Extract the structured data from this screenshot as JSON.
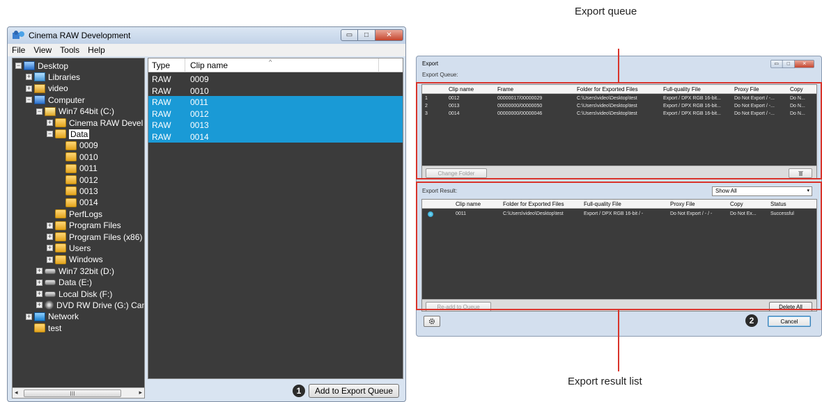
{
  "left_window": {
    "title": "Cinema RAW Development",
    "menu": [
      "File",
      "View",
      "Tools",
      "Help"
    ],
    "tree": [
      {
        "label": "Desktop",
        "icon": "computer",
        "depth": 0,
        "exp": "−"
      },
      {
        "label": "Libraries",
        "icon": "lib",
        "depth": 1,
        "exp": "+"
      },
      {
        "label": "video",
        "icon": "video",
        "depth": 1,
        "exp": "+"
      },
      {
        "label": "Computer",
        "icon": "computer",
        "depth": 1,
        "exp": "−"
      },
      {
        "label": "Win7 64bit (C:)",
        "icon": "winicon",
        "depth": 2,
        "exp": "−"
      },
      {
        "label": "Cinema RAW Devel",
        "icon": "folder",
        "depth": 3,
        "exp": "+"
      },
      {
        "label": "Data",
        "icon": "folder",
        "depth": 3,
        "exp": "−",
        "selected": true
      },
      {
        "label": "0009",
        "icon": "folder",
        "depth": 4,
        "exp": ""
      },
      {
        "label": "0010",
        "icon": "folder",
        "depth": 4,
        "exp": ""
      },
      {
        "label": "0011",
        "icon": "folder",
        "depth": 4,
        "exp": ""
      },
      {
        "label": "0012",
        "icon": "folder",
        "depth": 4,
        "exp": ""
      },
      {
        "label": "0013",
        "icon": "folder",
        "depth": 4,
        "exp": ""
      },
      {
        "label": "0014",
        "icon": "folder",
        "depth": 4,
        "exp": ""
      },
      {
        "label": "PerfLogs",
        "icon": "folder",
        "depth": 3,
        "exp": ""
      },
      {
        "label": "Program Files",
        "icon": "folder",
        "depth": 3,
        "exp": "+"
      },
      {
        "label": "Program Files (x86)",
        "icon": "folder",
        "depth": 3,
        "exp": "+"
      },
      {
        "label": "Users",
        "icon": "folder",
        "depth": 3,
        "exp": "+"
      },
      {
        "label": "Windows",
        "icon": "folder",
        "depth": 3,
        "exp": "+"
      },
      {
        "label": "Win7 32bit (D:)",
        "icon": "drive",
        "depth": 2,
        "exp": "+"
      },
      {
        "label": "Data (E:)",
        "icon": "drive",
        "depth": 2,
        "exp": "+"
      },
      {
        "label": "Local Disk (F:)",
        "icon": "drive",
        "depth": 2,
        "exp": "+"
      },
      {
        "label": "DVD RW Drive (G:) Can",
        "icon": "dvd",
        "depth": 2,
        "exp": "+"
      },
      {
        "label": "Network",
        "icon": "network",
        "depth": 1,
        "exp": "+"
      },
      {
        "label": "test",
        "icon": "folder",
        "depth": 1,
        "exp": ""
      }
    ],
    "scroll_label": "III",
    "clip_headers": {
      "type": "Type",
      "clip_name": "Clip name"
    },
    "clips": [
      {
        "type": "RAW",
        "name": "0009",
        "selected": false
      },
      {
        "type": "RAW",
        "name": "0010",
        "selected": false
      },
      {
        "type": "RAW",
        "name": "0011",
        "selected": true
      },
      {
        "type": "RAW",
        "name": "0012",
        "selected": true
      },
      {
        "type": "RAW",
        "name": "0013",
        "selected": true
      },
      {
        "type": "RAW",
        "name": "0014",
        "selected": true
      }
    ],
    "add_button": "Add to Export Queue",
    "badge": "1"
  },
  "export_window": {
    "title": "Export",
    "queue_label": "Export Queue:",
    "queue_headers": [
      "Clip name",
      "Frame",
      "Folder for Exported Files",
      "Full-quality File",
      "Proxy File",
      "Copy"
    ],
    "queue_rows": [
      [
        "1",
        "0012",
        "00000017/00000029",
        "C:\\Users\\video\\Desktop\\test",
        "Export / DPX RGB 16-bit...",
        "Do Not Export / -...",
        "Do N..."
      ],
      [
        "2",
        "0013",
        "00000000/00000050",
        "C:\\Users\\video\\Desktop\\test",
        "Export / DPX RGB 16-bit...",
        "Do Not Export / -...",
        "Do N..."
      ],
      [
        "3",
        "0014",
        "00000000/00000046",
        "C:\\Users\\video\\Desktop\\test",
        "Export / DPX RGB 16-bit...",
        "Do Not Export / -...",
        "Do N..."
      ]
    ],
    "change_folder": "Change Folder",
    "result_label": "Export Result:",
    "show_all": "Show All",
    "result_headers": [
      "Clip name",
      "Folder for Exported Files",
      "Full-quality File",
      "Proxy File",
      "Copy",
      "Status"
    ],
    "result_rows": [
      [
        "0011",
        "C:\\Users\\video\\Desktop\\test",
        "Export / DPX RGB 16-bit / -",
        "Do Not Export / - / -",
        "Do Not Ex...",
        "Successful"
      ]
    ],
    "readd": "Re-add to Queue",
    "delete_all": "Delete All",
    "cancel": "Cancel",
    "badge": "2"
  },
  "callouts": {
    "export_queue": "Export queue",
    "export_result_list": "Export result list"
  },
  "colors": {
    "selection": "#1a9ad6",
    "panel_bg": "#3b3b3b",
    "highlight": "#d9342b"
  }
}
